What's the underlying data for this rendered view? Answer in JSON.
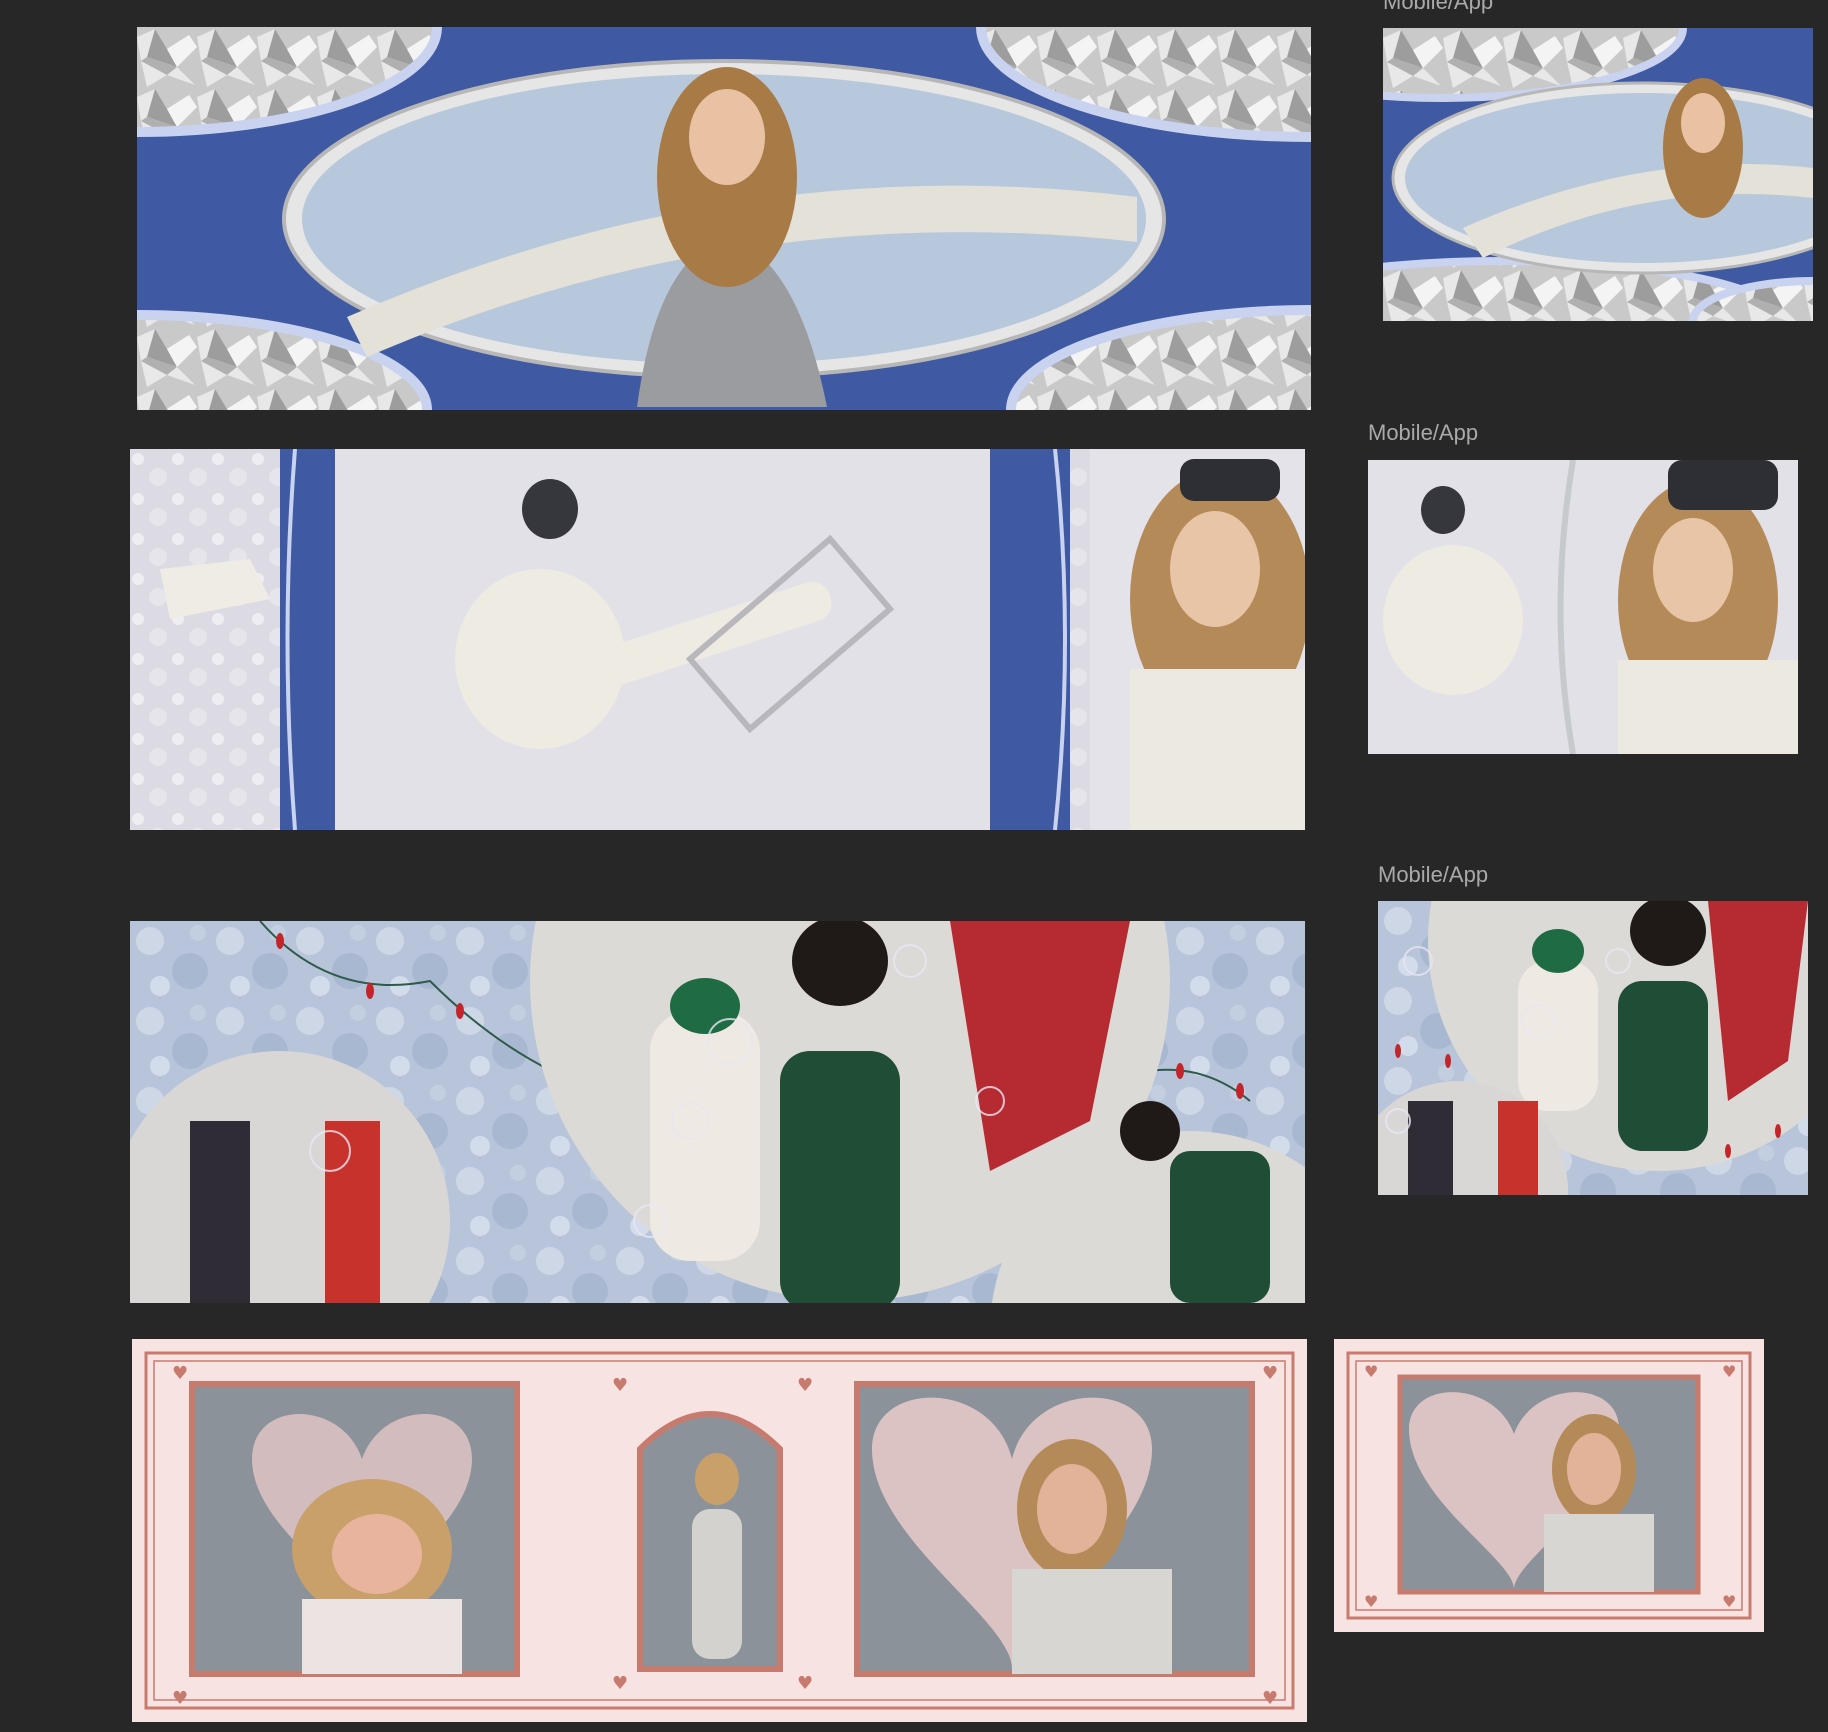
{
  "canvas": {
    "background": "#272727",
    "label_color": "#a9a9a9"
  },
  "frame_labels": {
    "mobile_1": "Mobile/App",
    "mobile_2": "Mobile/App",
    "mobile_3": "Mobile/App"
  },
  "palette": {
    "cobalt": "#3f5aa3",
    "periwinkle": "#c9d3f0",
    "foil": "#c8c8c8",
    "sky": "#b8c8dc",
    "snow": "#e9e7ee",
    "frost": "#b9c6dc",
    "blush": "#f7e4e2",
    "rose_line": "#c77b6f",
    "heart_pink": "#f0cfcd",
    "slate": "#8c929a"
  },
  "artboards": [
    {
      "name": "silver-oval-banner-desktop",
      "icon": "foil-oval-portrait"
    },
    {
      "name": "silver-oval-banner-mobile",
      "icon": "foil-oval-portrait"
    },
    {
      "name": "snow-chair-banner-desktop",
      "icon": "snow-model-triptych"
    },
    {
      "name": "snow-chair-banner-mobile",
      "icon": "snow-model-diptych"
    },
    {
      "name": "holiday-lights-banner-desktop",
      "icon": "circle-photo-collage"
    },
    {
      "name": "holiday-lights-banner-mobile",
      "icon": "circle-photo-collage"
    },
    {
      "name": "heart-frame-banner-desktop",
      "icon": "heart-frame-triptych"
    },
    {
      "name": "heart-frame-banner-mobile",
      "icon": "heart-frame-single"
    }
  ]
}
